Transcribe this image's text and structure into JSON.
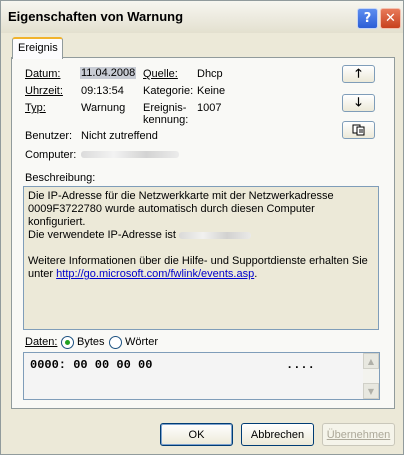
{
  "window": {
    "title": "Eigenschaften von Warnung",
    "help_glyph": "?",
    "close_glyph": "✕"
  },
  "tabs": [
    {
      "label": "Ereignis",
      "active": true
    }
  ],
  "event": {
    "date_label": "Datum:",
    "date": "11.04.2008",
    "time_label": "Uhrzeit:",
    "time": "09:13:54",
    "type_label": "Typ:",
    "type": "Warnung",
    "user_label": "Benutzer:",
    "user": "Nicht zutreffend",
    "computer_label": "Computer:",
    "source_label": "Quelle:",
    "source": "Dhcp",
    "category_label": "Kategorie:",
    "category": "Keine",
    "event_id_label_1": "Ereignis-",
    "event_id_label_2": "kennung:",
    "event_id": "1007"
  },
  "nav": {
    "up_icon": "arrow-up-icon",
    "down_icon": "arrow-down-icon",
    "copy_icon": "copy-icon"
  },
  "description": {
    "label": "Beschreibung:",
    "line1": "Die IP-Adresse für die Netzwerkkarte mit der Netzwerkadresse",
    "line2": "0009F3722780 wurde automatisch durch diesen Computer konfiguriert.",
    "line3": "Die verwendete IP-Adresse ist",
    "line4": "Weitere Informationen über die Hilfe- und Supportdienste erhalten Sie",
    "line5_prefix": "unter",
    "link": "http://go.microsoft.com/fwlink/events.asp",
    "line5_suffix": "."
  },
  "data": {
    "label": "Daten:",
    "bytes_label": "Bytes",
    "words_label": "Wörter",
    "selected": "bytes",
    "row": "0000: 00 00 00 00",
    "ascii": "...."
  },
  "buttons": {
    "ok": "OK",
    "cancel": "Abbrechen",
    "apply": "Übernehmen"
  },
  "colors": {
    "dialog_bg": "#ece9d8",
    "tab_highlight": "#f1b32d",
    "close_button": "#c7401e",
    "link": "#0000cc"
  }
}
